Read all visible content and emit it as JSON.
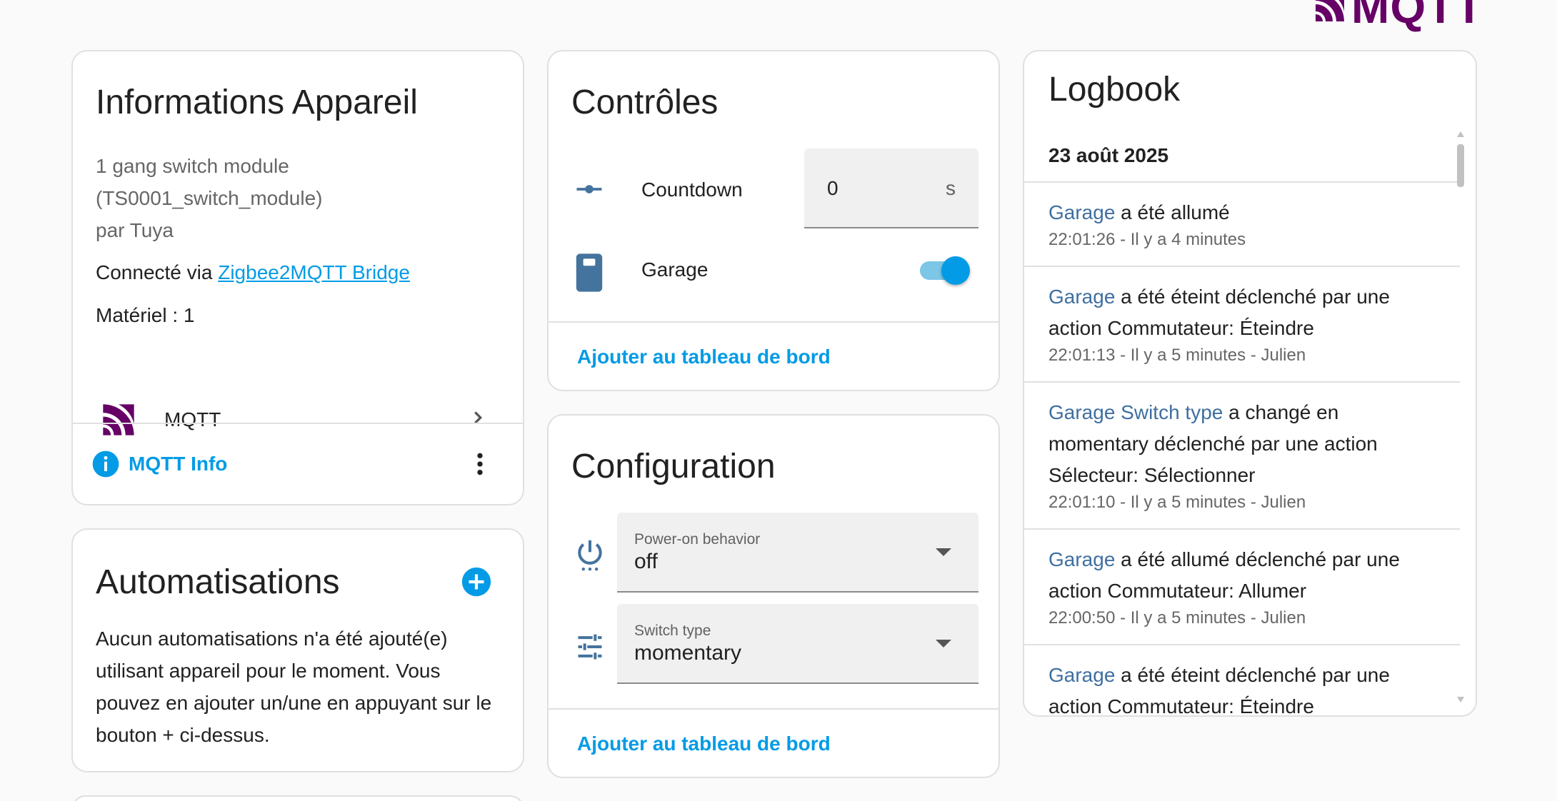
{
  "brand": {
    "logo_text": "MQTT"
  },
  "device_info": {
    "title": "Informations Appareil",
    "model_line1": "1 gang switch module",
    "model_line2": "(TS0001_switch_module)",
    "manufacturer": "par Tuya",
    "connected_prefix": "Connecté via",
    "connected_link": "Zigbee2MQTT Bridge",
    "hardware": "Matériel : 1",
    "integration_label": "MQTT",
    "mqtt_info_label": "MQTT Info"
  },
  "automations": {
    "title": "Automatisations",
    "empty_line1": "Aucun automatisations n'a été ajouté(e)",
    "empty_line2": "utilisant appareil pour le moment. Vous",
    "empty_line3": "pouvez en ajouter un/une en appuyant sur le",
    "empty_line4": "bouton + ci-dessus."
  },
  "controls": {
    "title": "Contrôles",
    "countdown_label": "Countdown",
    "countdown_value": "0",
    "countdown_unit": "s",
    "garage_label": "Garage",
    "garage_state": "on",
    "add_dashboard": "Ajouter au tableau de bord"
  },
  "configuration": {
    "title": "Configuration",
    "power_on_label": "Power-on behavior",
    "power_on_value": "off",
    "switch_type_label": "Switch type",
    "switch_type_value": "momentary",
    "add_dashboard": "Ajouter au tableau de bord"
  },
  "logbook": {
    "title": "Logbook",
    "date": "23 août 2025",
    "entries": [
      {
        "entity": "Garage",
        "msg1": " a été allumé",
        "msg2": "",
        "msg3": "",
        "time": "22:01:26 - Il y a 4 minutes"
      },
      {
        "entity": "Garage",
        "msg1": " a été éteint déclenché par une",
        "msg2": "action Commutateur: Éteindre",
        "msg3": "",
        "time": "22:01:13 - Il y a 5 minutes - Julien"
      },
      {
        "entity": "Garage Switch type",
        "msg1": " a changé en",
        "msg2": "momentary déclenché par une action",
        "msg3": "Sélecteur: Sélectionner",
        "time": "22:01:10 - Il y a 5 minutes - Julien"
      },
      {
        "entity": "Garage",
        "msg1": " a été allumé déclenché par une",
        "msg2": "action Commutateur: Allumer",
        "msg3": "",
        "time": "22:00:50 - Il y a 5 minutes - Julien"
      },
      {
        "entity": "Garage",
        "msg1": " a été éteint déclenché par une",
        "msg2": "action Commutateur: Éteindre",
        "msg3": "",
        "time": ""
      }
    ]
  },
  "colors": {
    "accent": "#039be5",
    "mqtt_purple": "#660066",
    "entity_link": "#3f6fa0",
    "icon_blue": "#44739e"
  }
}
